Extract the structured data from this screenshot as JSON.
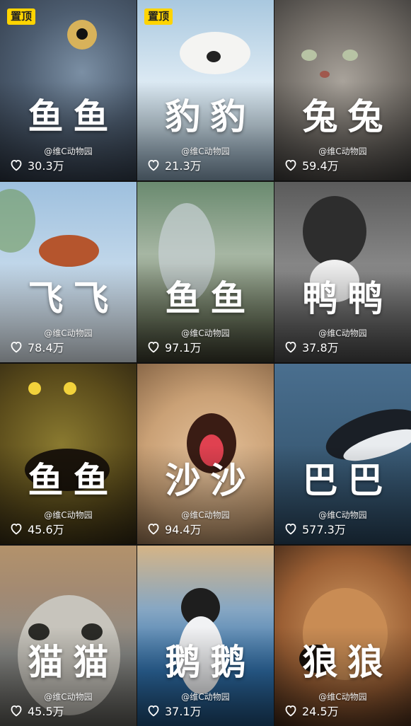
{
  "creator": "@维C动物园",
  "pin_label": "置顶",
  "tiles": [
    {
      "title": "鱼鱼",
      "likes": "30.3万",
      "pinned": true
    },
    {
      "title": "豹豹",
      "likes": "21.3万",
      "pinned": true
    },
    {
      "title": "兔兔",
      "likes": "59.4万",
      "pinned": false
    },
    {
      "title": "飞飞",
      "likes": "78.4万",
      "pinned": false
    },
    {
      "title": "鱼鱼",
      "likes": "97.1万",
      "pinned": false
    },
    {
      "title": "鸭鸭",
      "likes": "37.8万",
      "pinned": false
    },
    {
      "title": "鱼鱼",
      "likes": "45.6万",
      "pinned": false
    },
    {
      "title": "沙沙",
      "likes": "94.4万",
      "pinned": false
    },
    {
      "title": "巴巴",
      "likes": "577.3万",
      "pinned": false
    },
    {
      "title": "猫猫",
      "likes": "45.5万",
      "pinned": false
    },
    {
      "title": "鹅鹅",
      "likes": "37.1万",
      "pinned": false
    },
    {
      "title": "狼狼",
      "likes": "24.5万",
      "pinned": false
    }
  ],
  "colors": {
    "pin_badge": "#ffd400",
    "text": "#ffffff"
  },
  "icons": {
    "like": "heart-outline-icon"
  }
}
